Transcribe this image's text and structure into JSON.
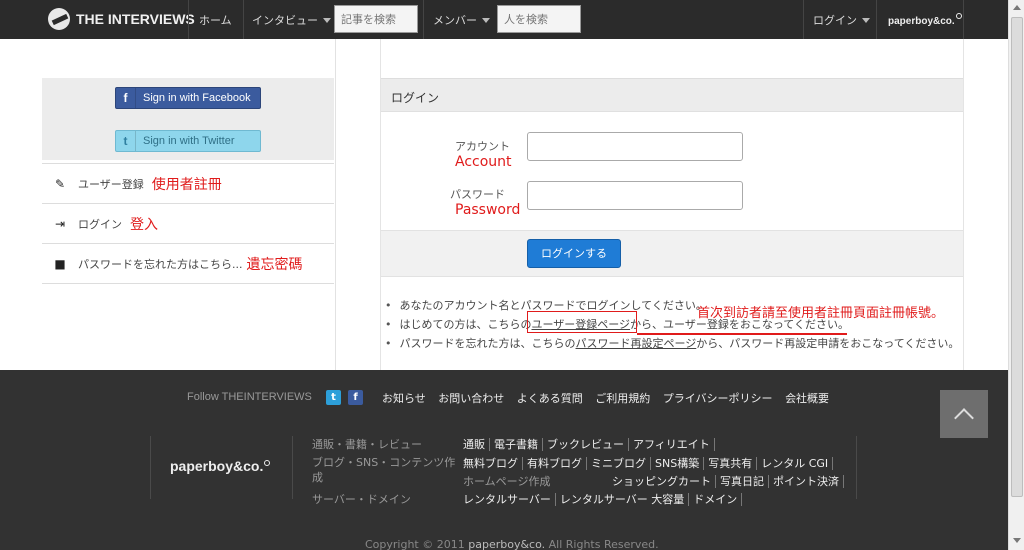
{
  "header": {
    "logo_text": "THE INTERVIEWS",
    "nav": [
      "ホーム",
      "インタビュー",
      "メンバー",
      "ログイン"
    ],
    "search_articles_placeholder": "記事を検索",
    "search_people_placeholder": "人を検索",
    "brand": "paperboy&co."
  },
  "sidebar": {
    "facebook_btn": "Sign in with Facebook",
    "twitter_btn": "Sign in with Twitter",
    "items": [
      {
        "label": "ユーザー登録",
        "annotation": "使用者註冊"
      },
      {
        "label": "ログイン",
        "annotation": "登入"
      },
      {
        "label": "パスワードを忘れた方はこちら...",
        "annotation": "遺忘密碼"
      }
    ]
  },
  "login": {
    "title": "ログイン",
    "account_label": "アカウント",
    "account_annotation": "Account",
    "password_label": "パスワード",
    "password_annotation": "Password",
    "submit": "ログインする",
    "notes": {
      "line1": "あなたのアカウント名とパスワードでログインしてください。",
      "line2_pre": "はじめての方は、こちらの",
      "line2_link": "ユーザー登録ページ",
      "line2_post": "から、ユーザー登録をおこなってください。",
      "line3_pre": "パスワードを忘れた方は、こちらの",
      "line3_link": "パスワード再設定ページ",
      "line3_post": "から、パスワード再設定申請をおこなってください。"
    },
    "annotation": "首次到訪者請至使用者註冊頁面註冊帳號。"
  },
  "footer": {
    "follow": "Follow THEINTERVIEWS",
    "links": [
      "お知らせ",
      "お問い合わせ",
      "よくある質問",
      "ご利用規約",
      "プライバシーポリシー",
      "会社概要"
    ],
    "brand": "paperboy&co.",
    "categories": [
      "通販・書籍・レビュー",
      "ブログ・SNS・コンテンツ作",
      "成",
      "ホームページ作成",
      "サーバー・ドメイン"
    ],
    "row1": [
      "通販",
      "電子書籍",
      "ブックレビュー",
      "アフィリエイト"
    ],
    "row2": [
      "無料ブログ",
      "有料ブログ",
      "ミニブログ",
      "SNS構築",
      "写真共有",
      "レンタル CGI"
    ],
    "row3": [
      "ショッピングカート",
      "写真日記",
      "ポイント決済"
    ],
    "row4": [
      "レンタルサーバー",
      "レンタルサーバー 大容量",
      "ドメイン"
    ],
    "copyright_pre": "Copyright © 2011",
    "copyright_brand": "paperboy&co.",
    "copyright_post": "All Rights Reserved."
  },
  "colors": {
    "header_bg": "#2b2b2b",
    "footer_bg": "#323232",
    "login_button": "#1f7cd6",
    "facebook": "#3b5b9e",
    "twitter": "#8ed6ec",
    "annotation_red": "#e01b1b"
  }
}
